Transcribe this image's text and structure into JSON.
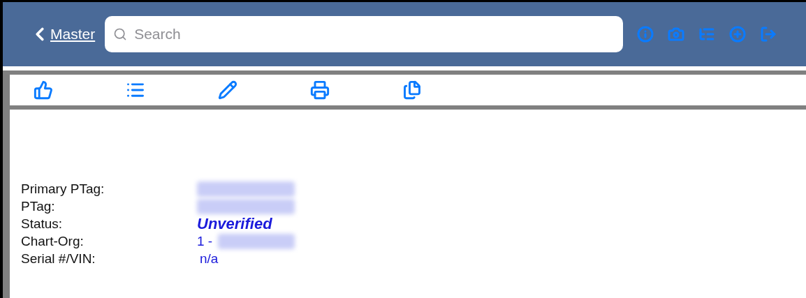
{
  "nav": {
    "back_label": "Master"
  },
  "search": {
    "placeholder": "Search"
  },
  "fields": [
    {
      "label": "Primary PTag:",
      "kind": "blurred"
    },
    {
      "label": "PTag:",
      "kind": "blurred"
    },
    {
      "label": "Status:",
      "kind": "emphasis",
      "value": "Unverified"
    },
    {
      "label": "Chart-Org:",
      "kind": "text_blurred",
      "value": "1 -"
    },
    {
      "label": "Serial #/VIN:",
      "kind": "text",
      "value": "n/a"
    }
  ]
}
